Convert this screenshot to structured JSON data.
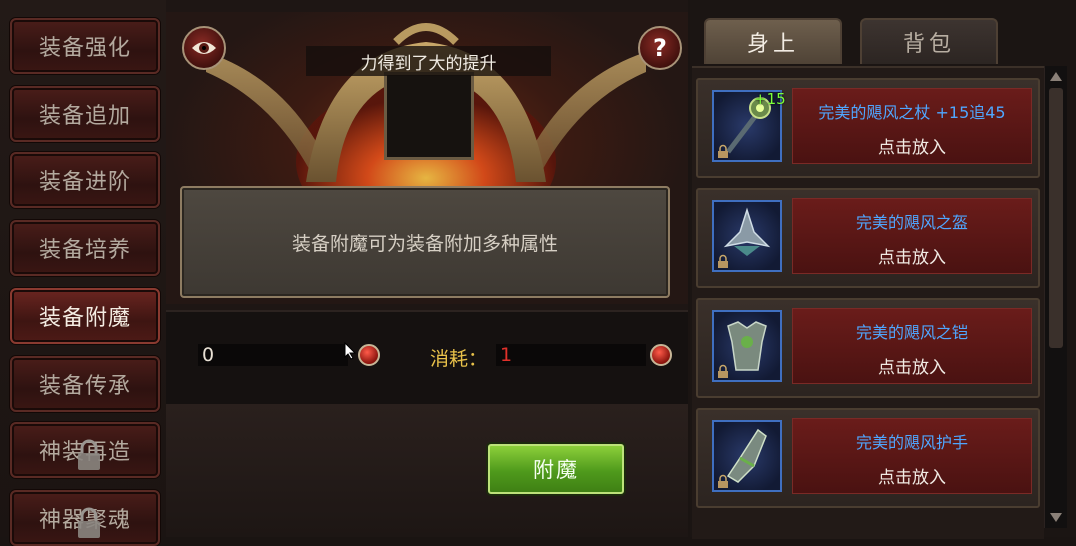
{
  "menu": {
    "items": [
      {
        "label": "装备强化",
        "active": false,
        "locked": false
      },
      {
        "label": "装备追加",
        "active": false,
        "locked": false
      },
      {
        "label": "装备进阶",
        "active": false,
        "locked": false
      },
      {
        "label": "装备培养",
        "active": false,
        "locked": false
      },
      {
        "label": "装备附魔",
        "active": true,
        "locked": false
      },
      {
        "label": "装备传承",
        "active": false,
        "locked": false
      },
      {
        "label": "神装再造",
        "active": false,
        "locked": true
      },
      {
        "label": "神器聚魂",
        "active": false,
        "locked": true
      }
    ]
  },
  "center": {
    "caption": "力得到了大的提升",
    "description": "装备附魔可为装备附加多种属性",
    "left_value": "0",
    "cost_label": "消耗：",
    "cost_value": "1",
    "enchant_button": "附魔",
    "help_symbol": "?"
  },
  "tabs": {
    "body": "身上",
    "bag": "背包"
  },
  "items": [
    {
      "name": "完美的飓风之杖 +15追45",
      "action": "点击放入",
      "badge": "+15",
      "icon": "staff-icon"
    },
    {
      "name": "完美的飓风之盔",
      "action": "点击放入",
      "badge": "",
      "icon": "helmet-icon"
    },
    {
      "name": "完美的飓风之铠",
      "action": "点击放入",
      "badge": "",
      "icon": "armor-icon"
    },
    {
      "name": "完美的飓风护手",
      "action": "点击放入",
      "badge": "",
      "icon": "gauntlet-icon"
    }
  ],
  "colors": {
    "item_name": "#4fa6ff",
    "cost_label": "#e8c14a",
    "cost_value": "#e0302a",
    "enchant_button": "#6cb52a"
  }
}
